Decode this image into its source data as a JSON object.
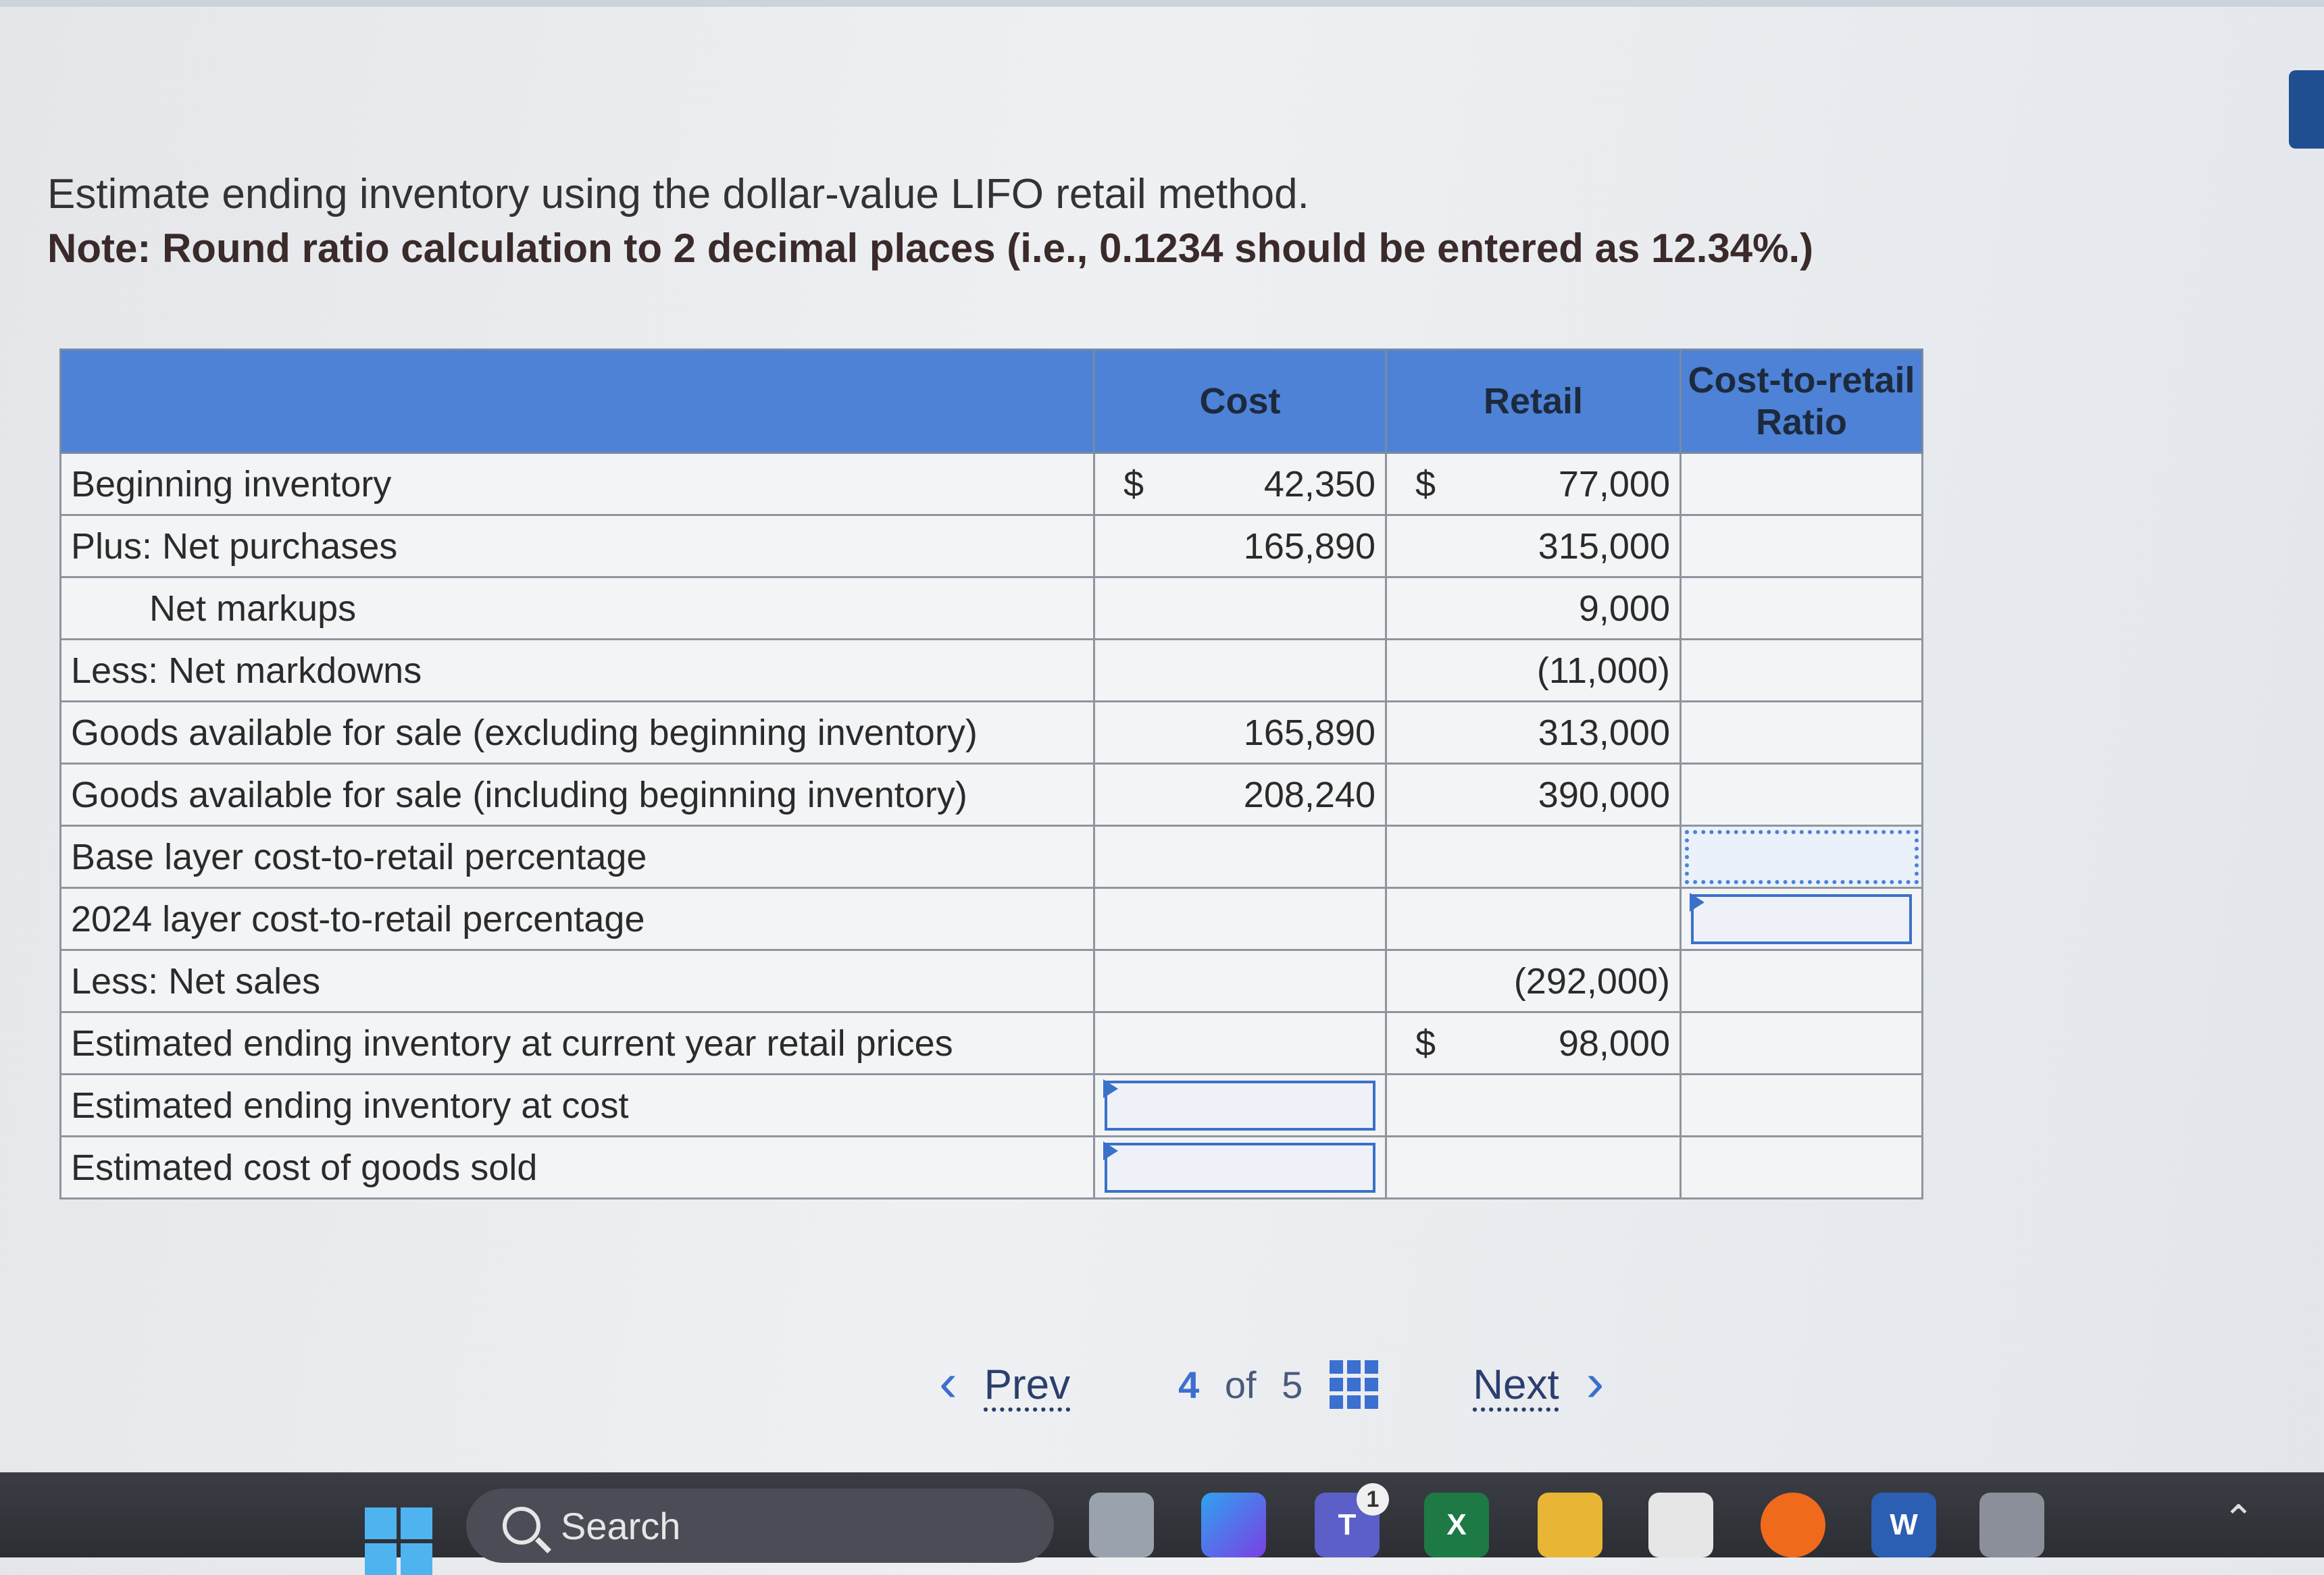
{
  "instructions": {
    "line1": "Estimate ending inventory using the dollar-value LIFO retail method.",
    "note": "Note: Round ratio calculation to 2 decimal places (i.e., 0.1234 should be entered as 12.34%.)"
  },
  "table": {
    "headers": {
      "label": "",
      "cost": "Cost",
      "retail": "Retail",
      "ratio": "Cost-to-retail Ratio"
    },
    "rows": {
      "beginning_inventory": {
        "label": "Beginning inventory",
        "cost_dollar": "$",
        "cost": "42,350",
        "retail_dollar": "$",
        "retail": "77,000"
      },
      "net_purchases": {
        "label": "Plus: Net purchases",
        "cost": "165,890",
        "retail": "315,000"
      },
      "net_markups": {
        "label": "Net markups",
        "retail": "9,000"
      },
      "net_markdowns": {
        "label": "Less: Net markdowns",
        "retail": "(11,000)"
      },
      "gafs_excl": {
        "label": "Goods available for sale (excluding beginning inventory)",
        "cost": "165,890",
        "retail": "313,000"
      },
      "gafs_incl": {
        "label": "Goods available for sale (including beginning inventory)",
        "cost": "208,240",
        "retail": "390,000"
      },
      "base_layer_pct": {
        "label": "Base layer cost-to-retail percentage"
      },
      "layer_2024_pct": {
        "label": "2024 layer cost-to-retail percentage"
      },
      "net_sales": {
        "label": "Less: Net sales",
        "retail": "(292,000)"
      },
      "ending_retail": {
        "label": "Estimated ending inventory at current year retail prices",
        "retail_dollar": "$",
        "retail": "98,000"
      },
      "ending_cost": {
        "label": "Estimated ending inventory at cost"
      },
      "cogs": {
        "label": "Estimated cost of goods sold"
      }
    }
  },
  "pager": {
    "prev": "Prev",
    "current": "4",
    "of": "of",
    "total": "5",
    "next": "Next"
  },
  "taskbar": {
    "search_placeholder": "Search",
    "teams_badge": "1"
  },
  "colors": {
    "header_blue": "#4d82d6",
    "input_border": "#3b71c8",
    "taskbar": "#2f3137"
  }
}
